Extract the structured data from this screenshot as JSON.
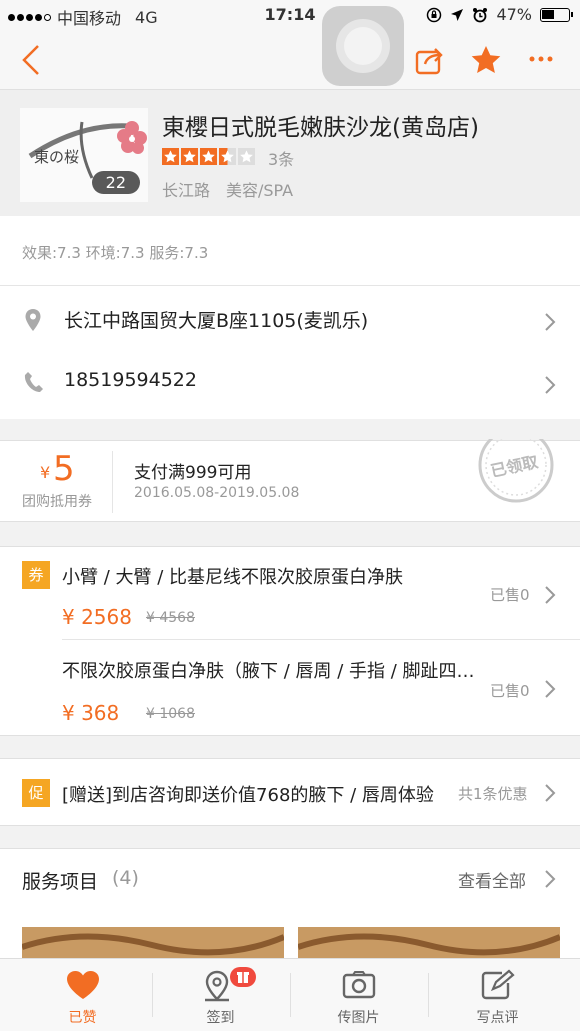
{
  "status_bar": {
    "carrier": "中国移动",
    "network": "4G",
    "time": "17:14",
    "battery": "47%"
  },
  "shop": {
    "name": "東櫻日式脱毛嫩肤沙龙(黄岛店)",
    "photo_count": "22",
    "logo_text": "東の桜",
    "rating_stars": 3.5,
    "review_count": "3条",
    "district": "长江路",
    "category": "美容/SPA",
    "scores": "效果:7.3 环境:7.3 服务:7.3"
  },
  "contact": {
    "address": "长江中路国贸大厦B座1105(麦凯乐)",
    "phone": "18519594522"
  },
  "voucher": {
    "currency": "¥",
    "amount": "5",
    "label": "团购抵用券",
    "condition": "支付满999可用",
    "validity": "2016.05.08-2019.05.08",
    "stamp": "已领取"
  },
  "deals": {
    "tag": "券",
    "items": [
      {
        "title": "小臂 / 大臂 / 比基尼线不限次胶原蛋白净肤",
        "price": "¥ 2568",
        "original": "¥ 4568",
        "sold": "已售0"
      },
      {
        "title": "不限次胶原蛋白净肤（腋下 / 唇周 / 手指 / 脚趾四选一）",
        "price": "¥ 368",
        "original": "¥ 1068",
        "sold": "已售0"
      }
    ]
  },
  "promo": {
    "tag": "促",
    "text": "[赠送]到店咨询即送价值768的腋下 / 唇周体验",
    "count": "共1条优惠"
  },
  "services": {
    "title": "服务项目",
    "count": "(4)",
    "view_all": "查看全部"
  },
  "tabbar": {
    "tabs": [
      {
        "label": "已赞"
      },
      {
        "label": "签到"
      },
      {
        "label": "传图片"
      },
      {
        "label": "写点评"
      }
    ]
  },
  "colors": {
    "accent": "#f26d23",
    "tag": "#f5a623"
  }
}
